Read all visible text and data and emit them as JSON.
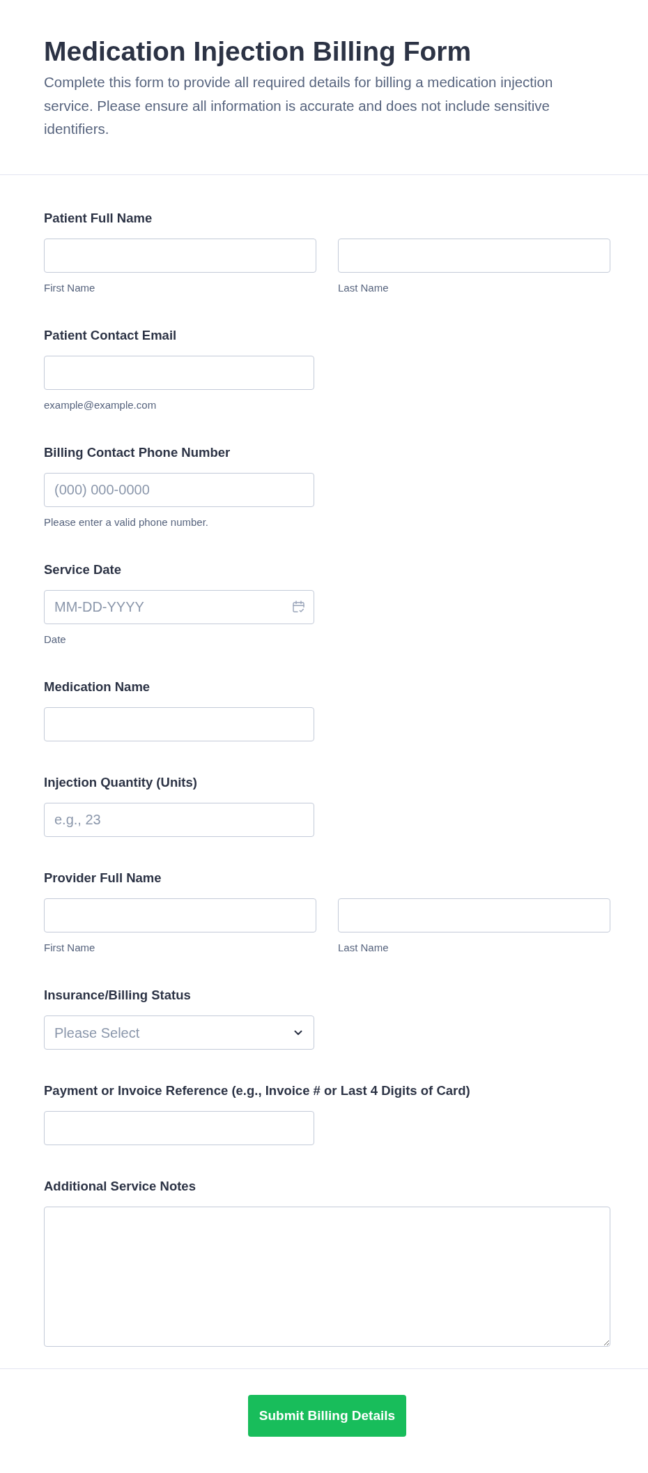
{
  "header": {
    "title": "Medication Injection Billing Form",
    "description": "Complete this form to provide all required details for billing a medication injection service. Please ensure all information is accurate and does not include sensitive identifiers."
  },
  "fields": [
    {
      "kind": "name",
      "label": "Patient Full Name",
      "parts": [
        {
          "sublabel": "First Name"
        },
        {
          "sublabel": "Last Name"
        }
      ]
    },
    {
      "kind": "email",
      "label": "Patient Contact Email",
      "sublabel": "example@example.com"
    },
    {
      "kind": "phone",
      "label": "Billing Contact Phone Number",
      "placeholder": "(000) 000-0000",
      "sublabel": "Please enter a valid phone number."
    },
    {
      "kind": "date",
      "label": "Service Date",
      "placeholder": "MM-DD-YYYY",
      "sublabel": "Date"
    },
    {
      "kind": "text",
      "label": "Medication Name"
    },
    {
      "kind": "number",
      "label": "Injection Quantity (Units)",
      "placeholder": "e.g., 23"
    },
    {
      "kind": "name",
      "label": "Provider Full Name",
      "parts": [
        {
          "sublabel": "First Name"
        },
        {
          "sublabel": "Last Name"
        }
      ]
    },
    {
      "kind": "select",
      "label": "Insurance/Billing Status",
      "placeholder": "Please Select"
    },
    {
      "kind": "text",
      "label": "Payment or Invoice Reference (e.g., Invoice # or Last 4 Digits of Card)"
    },
    {
      "kind": "textarea",
      "label": "Additional Service Notes"
    }
  ],
  "submit_button": {
    "label": "Submit Billing Details"
  }
}
